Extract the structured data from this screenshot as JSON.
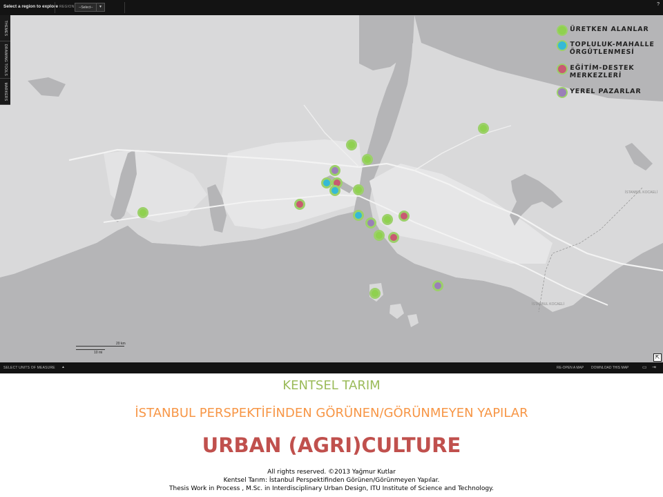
{
  "topbar": {
    "region_title": "Select a region to explore",
    "region_label": "REGION",
    "region_select_value": "--Select--",
    "help_label": "?"
  },
  "sidetabs": [
    "THEMES",
    "DRAWING TOOLS",
    "MARKERS"
  ],
  "legend": [
    {
      "label": "ÜRETKEN ALANLAR",
      "color": "#8fd14f"
    },
    {
      "label": "TOPLULUK-MAHALLE ÖRGÜTLENMESİ",
      "color": "#35b9d6"
    },
    {
      "label": "EĞİTİM-DESTEK MERKEZLERİ",
      "color": "#c85a72"
    },
    {
      "label": "YEREL PAZARLAR",
      "color": "#9a7fb8"
    }
  ],
  "map": {
    "scale_km": "20 km",
    "scale_mi": "10 mi",
    "labels": {
      "istanbul_kocaeli_1": "İSTANBUL KOCAELİ",
      "istanbul_kocaeli_2": "İSTANBUL KOCAELİ"
    }
  },
  "markers": [
    {
      "type": "production",
      "fill": "#8fd14f"
    },
    {
      "type": "production",
      "fill": "#8fd14f"
    },
    {
      "type": "production",
      "fill": "#8fd14f"
    },
    {
      "type": "market",
      "fill": "#9a7fb8"
    },
    {
      "type": "community",
      "fill": "#35b9d6"
    },
    {
      "type": "education",
      "fill": "#c85a72"
    },
    {
      "type": "community",
      "fill": "#35b9d6"
    },
    {
      "type": "production",
      "fill": "#8fd14f"
    },
    {
      "type": "education",
      "fill": "#c85a72"
    },
    {
      "type": "production",
      "fill": "#8fd14f"
    },
    {
      "type": "community",
      "fill": "#35b9d6"
    },
    {
      "type": "market",
      "fill": "#9a7fb8"
    },
    {
      "type": "production",
      "fill": "#8fd14f"
    },
    {
      "type": "education",
      "fill": "#c85a72"
    },
    {
      "type": "production",
      "fill": "#8fd14f"
    },
    {
      "type": "education",
      "fill": "#c85a72"
    },
    {
      "type": "production",
      "fill": "#8fd14f"
    },
    {
      "type": "market",
      "fill": "#9a7fb8"
    }
  ],
  "bottombar": {
    "units_label": "SELECT UNITS OF MEASURE",
    "reopen_label": "RE-OPEN A MAP",
    "download_label": "DOWNLOAD THIS MAP"
  },
  "caption": {
    "line1": "KENTSEL TARIM",
    "line2": "İSTANBUL PERSPEKTİFİNDEN GÖRÜNEN/GÖRÜNMEYEN YAPILAR",
    "line3": "URBAN (AGRI)CULTURE"
  },
  "credits": [
    "All rights reserved. ©2013 Yağmur Kutlar",
    "Kentsel Tarım: İstanbul Perspektifinden Görünen/Görünmeyen Yapılar.",
    "Thesis Work in Process , M.Sc. in Interdisciplinary Urban Design, ITU Institute of Science and Technology."
  ]
}
